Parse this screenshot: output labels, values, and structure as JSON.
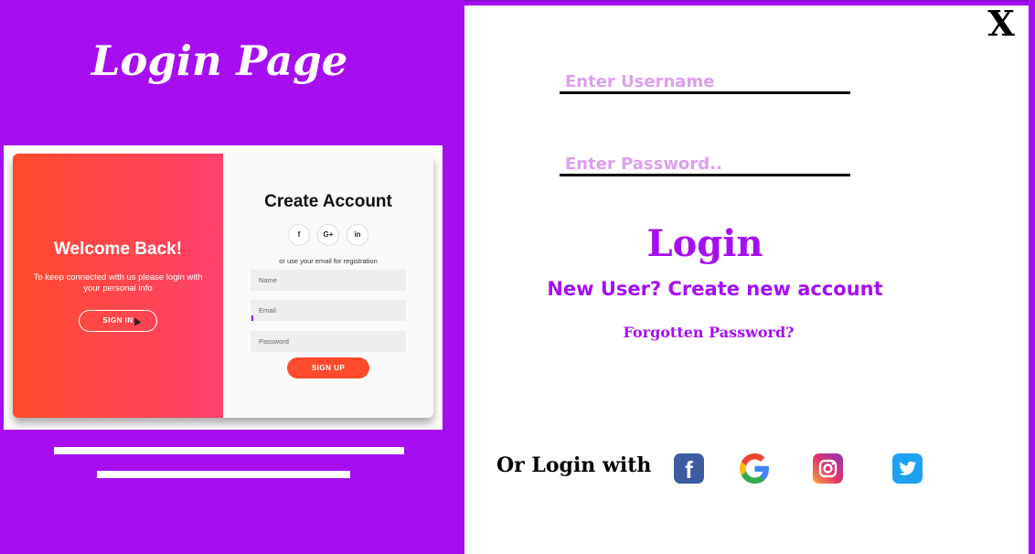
{
  "left_panel": {
    "title": "Login Page",
    "preview": {
      "welcome_title": "Welcome Back!",
      "welcome_text": "To keep connected with us please login with your personal info",
      "sign_in_label": "SIGN IN",
      "create_title": "Create Account",
      "social_labels": [
        "f",
        "G+",
        "in"
      ],
      "use_email_text": "or use your email for registration",
      "placeholders": [
        "Name",
        "Email",
        "Password"
      ],
      "sign_up_label": "SIGN UP"
    }
  },
  "right_panel": {
    "close_label": "X",
    "username_placeholder": "Enter Username",
    "password_placeholder": "Enter Password..",
    "login_label": "Login",
    "new_user_label": "New User? Create new account",
    "forgot_label": "Forgotten Password?",
    "or_login_label": "Or Login with",
    "social_icons": [
      "facebook-icon",
      "google-icon",
      "instagram-icon",
      "twitter-icon"
    ],
    "facebook_glyph": "f"
  },
  "colors": {
    "accent_purple": "#a60ef0",
    "preview_gradient_start": "#ff4b2b",
    "preview_gradient_end": "#ff416c",
    "placeholder": "#dca0ec"
  }
}
